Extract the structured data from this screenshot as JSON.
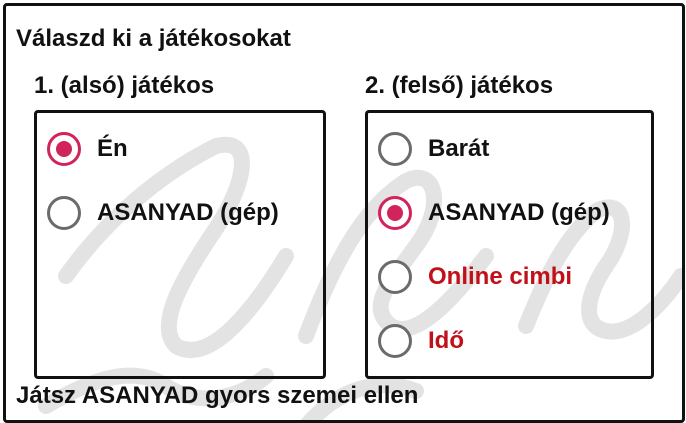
{
  "title": "Válaszd ki a játékosokat",
  "player1": {
    "heading": "1. (alsó) játékos",
    "options": [
      {
        "label": "Én",
        "checked": true
      },
      {
        "label": "ASANYAD (gép)",
        "checked": false
      }
    ]
  },
  "player2": {
    "heading": "2. (felső) játékos",
    "options": [
      {
        "label": "Barát",
        "checked": false
      },
      {
        "label": "ASANYAD (gép)",
        "checked": true
      },
      {
        "label": "Online cimbi",
        "checked": false
      },
      {
        "label": "Idő",
        "checked": false
      }
    ]
  },
  "footer": "Játsz ASANYAD gyors szemei ellen",
  "colors": {
    "accent": "#d1245a",
    "warning_text": "#c0111a",
    "radio_unchecked": "#6b6b6b",
    "border": "#111111"
  },
  "icons": {
    "checked": "radio-checked-icon",
    "unchecked": "radio-unchecked-icon"
  }
}
